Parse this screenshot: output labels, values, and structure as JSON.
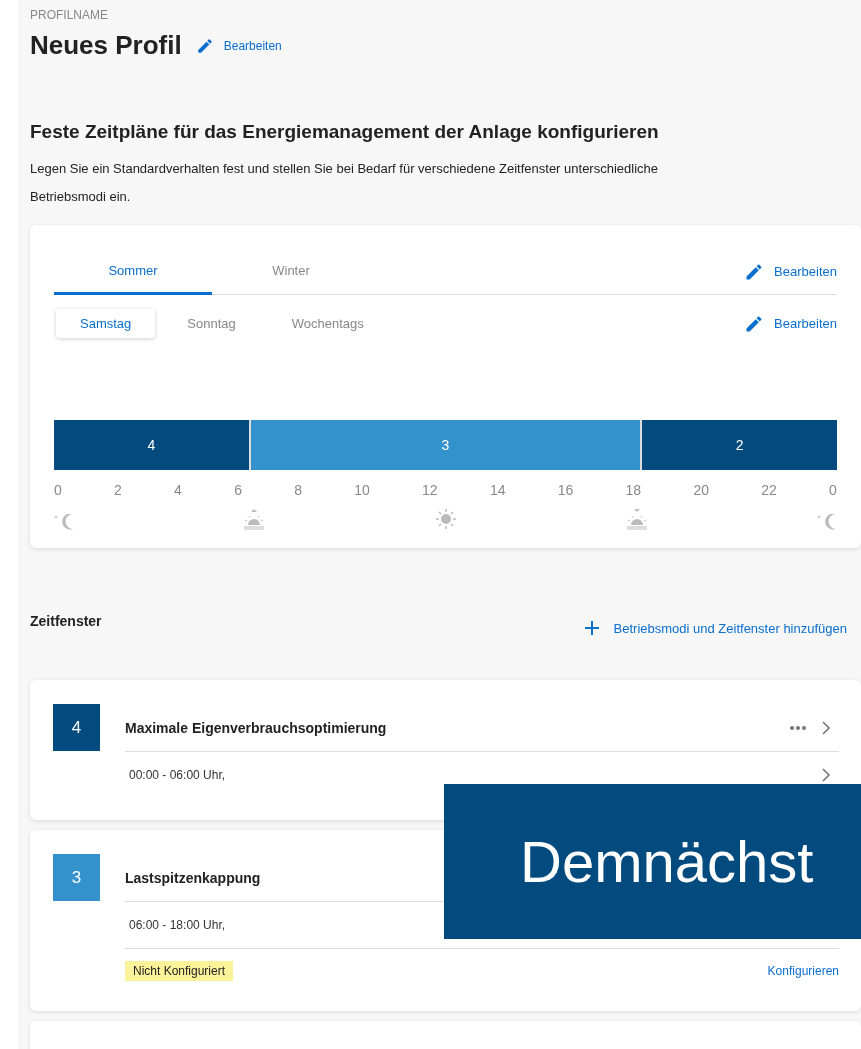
{
  "profile": {
    "caption": "PROFILNAME",
    "name": "Neues Profil",
    "edit_label": "Bearbeiten"
  },
  "intro": {
    "heading": "Feste Zeitpläne für das Energiemanagement der Anlage konfigurieren",
    "text": "Legen Sie ein Standardverhalten fest und stellen Sie bei Bedarf für verschiedene Zeitfenster unterschiedliche Betriebsmodi ein."
  },
  "schedule": {
    "season_tabs": [
      {
        "label": "Sommer",
        "selected": true
      },
      {
        "label": "Winter",
        "selected": false
      }
    ],
    "season_edit": "Bearbeiten",
    "day_tabs": [
      {
        "label": "Samstag",
        "selected": true
      },
      {
        "label": "Sonntag",
        "selected": false
      },
      {
        "label": "Wochentags",
        "selected": false
      }
    ],
    "day_edit": "Bearbeiten",
    "segments": [
      {
        "label": "4",
        "level": 0.25,
        "color": "#034a7f"
      },
      {
        "label": "3",
        "level": 0.5,
        "color": "#3391cc"
      },
      {
        "label": "2",
        "level": 0.25,
        "color": "#034a7f"
      }
    ],
    "ticks": [
      "0",
      "2",
      "4",
      "6",
      "8",
      "10",
      "12",
      "14",
      "16",
      "18",
      "20",
      "22",
      "0"
    ],
    "sun_icons": [
      {
        "kind": "moon"
      },
      {
        "kind": "sunrise"
      },
      {
        "kind": "sun"
      },
      {
        "kind": "sunset"
      },
      {
        "kind": "moon"
      }
    ]
  },
  "time_windows": {
    "heading": "Zeitfenster",
    "add_label": "Betriebsmodi und Zeitfenster hinzufügen",
    "items": [
      {
        "number": "4",
        "color": "#034a7f",
        "title": "Maximale Eigenverbrauchsoptimierung",
        "time": "00:00 - 06:00 Uhr,",
        "menu": true
      },
      {
        "number": "3",
        "color": "#3391cc",
        "title": "Lastspitzenkappung",
        "time": "06:00 - 18:00 Uhr,",
        "status": "Nicht Konfiguriert",
        "action": "Konfigurieren"
      }
    ]
  },
  "banner": {
    "text": "Demnächst"
  }
}
